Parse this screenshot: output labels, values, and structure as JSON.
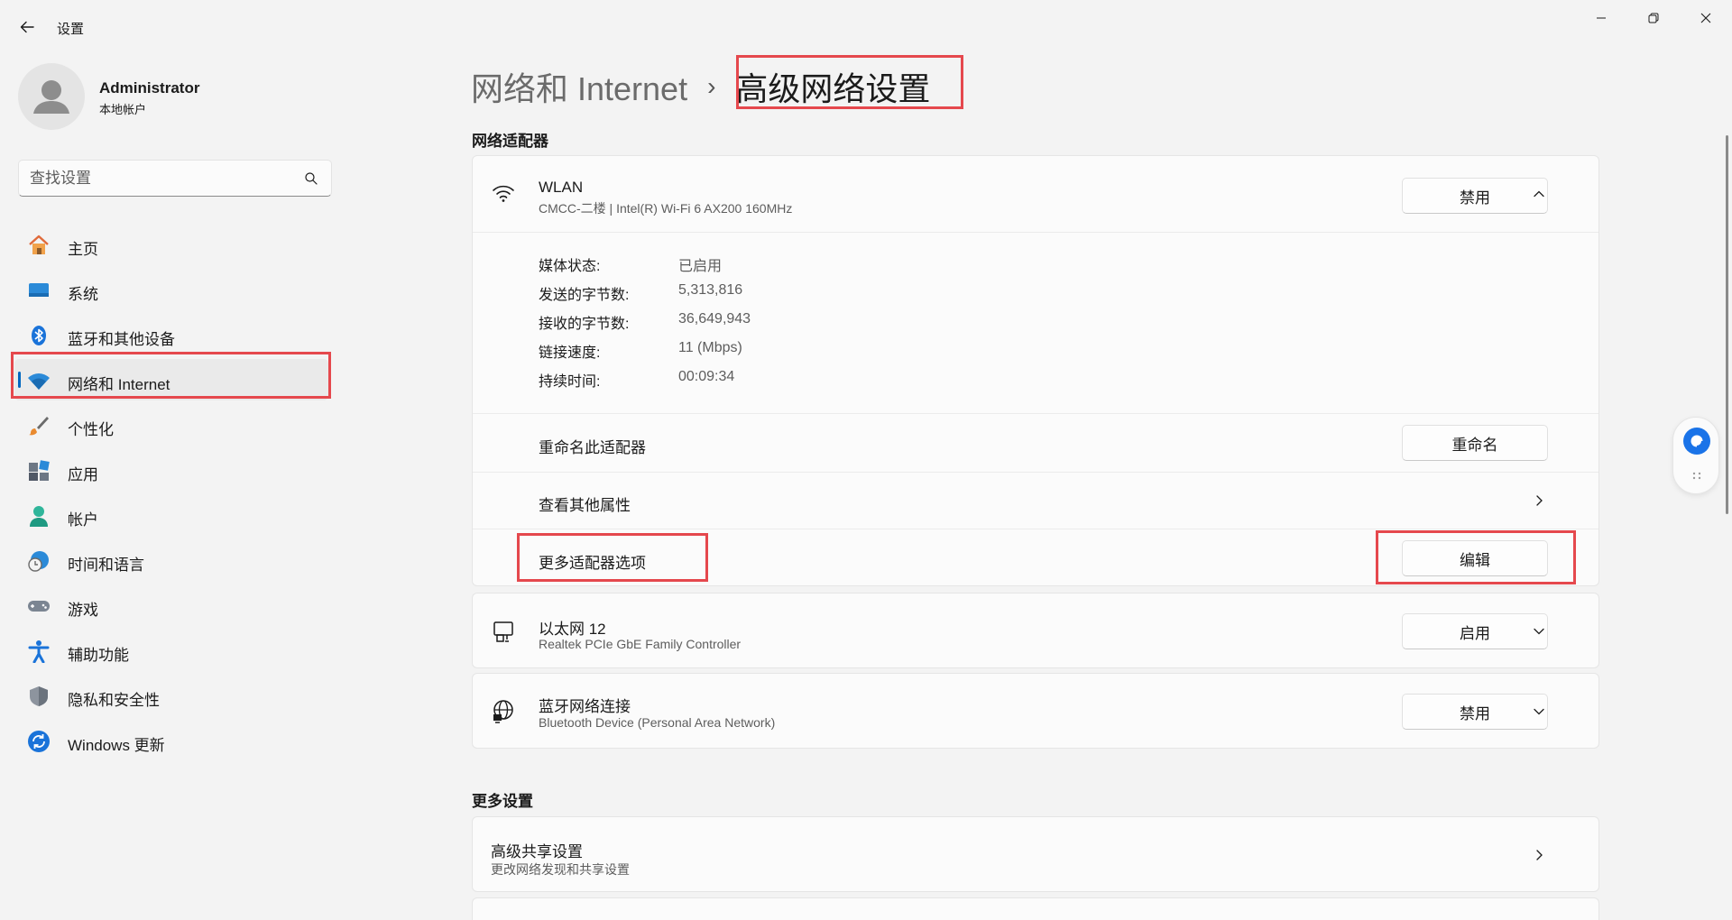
{
  "app": {
    "title": "设置",
    "back_icon": "back-arrow-icon",
    "window_controls": [
      "minimize-icon",
      "maximize-icon",
      "close-icon"
    ]
  },
  "profile": {
    "name": "Administrator",
    "account_type": "本地帐户"
  },
  "search": {
    "placeholder": "查找设置"
  },
  "nav": {
    "items": [
      {
        "label": "主页",
        "icon": "home-icon"
      },
      {
        "label": "系统",
        "icon": "system-icon"
      },
      {
        "label": "蓝牙和其他设备",
        "icon": "bluetooth-icon"
      },
      {
        "label": "网络和 Internet",
        "icon": "wifi-icon",
        "active": true
      },
      {
        "label": "个性化",
        "icon": "brush-icon"
      },
      {
        "label": "应用",
        "icon": "apps-icon"
      },
      {
        "label": "帐户",
        "icon": "account-icon"
      },
      {
        "label": "时间和语言",
        "icon": "time-language-icon"
      },
      {
        "label": "游戏",
        "icon": "gamepad-icon"
      },
      {
        "label": "辅助功能",
        "icon": "accessibility-icon"
      },
      {
        "label": "隐私和安全性",
        "icon": "shield-icon"
      },
      {
        "label": "Windows 更新",
        "icon": "update-icon"
      }
    ]
  },
  "breadcrumb": {
    "parent": "网络和 Internet",
    "separator": "›",
    "current": "高级网络设置"
  },
  "sections": {
    "adapters_title": "网络适配器",
    "more_settings_title": "更多设置"
  },
  "wlan": {
    "name": "WLAN",
    "description": "CMCC-二楼 | Intel(R) Wi-Fi 6 AX200 160MHz",
    "button": "禁用",
    "expanded": true,
    "properties": [
      {
        "label": "媒体状态:",
        "value": "已启用"
      },
      {
        "label": "发送的字节数:",
        "value": "5,313,816"
      },
      {
        "label": "接收的字节数:",
        "value": "36,649,943"
      },
      {
        "label": "链接速度:",
        "value": "11 (Mbps)"
      },
      {
        "label": "持续时间:",
        "value": "00:09:34"
      }
    ],
    "rename_label": "重命名此适配器",
    "rename_button": "重命名",
    "more_props_label": "查看其他属性",
    "more_options_label": "更多适配器选项",
    "edit_button": "编辑"
  },
  "ethernet": {
    "name": "以太网 12",
    "description": "Realtek PCIe GbE Family Controller",
    "button": "启用"
  },
  "bluetooth_net": {
    "name": "蓝牙网络连接",
    "description": "Bluetooth Device (Personal Area Network)",
    "button": "禁用"
  },
  "sharing": {
    "title": "高级共享设置",
    "description": "更改网络发现和共享设置"
  },
  "colors": {
    "accent": "#0067c0",
    "highlight": "#e5484d",
    "background": "#f3f3f3",
    "card": "#fbfbfb"
  }
}
